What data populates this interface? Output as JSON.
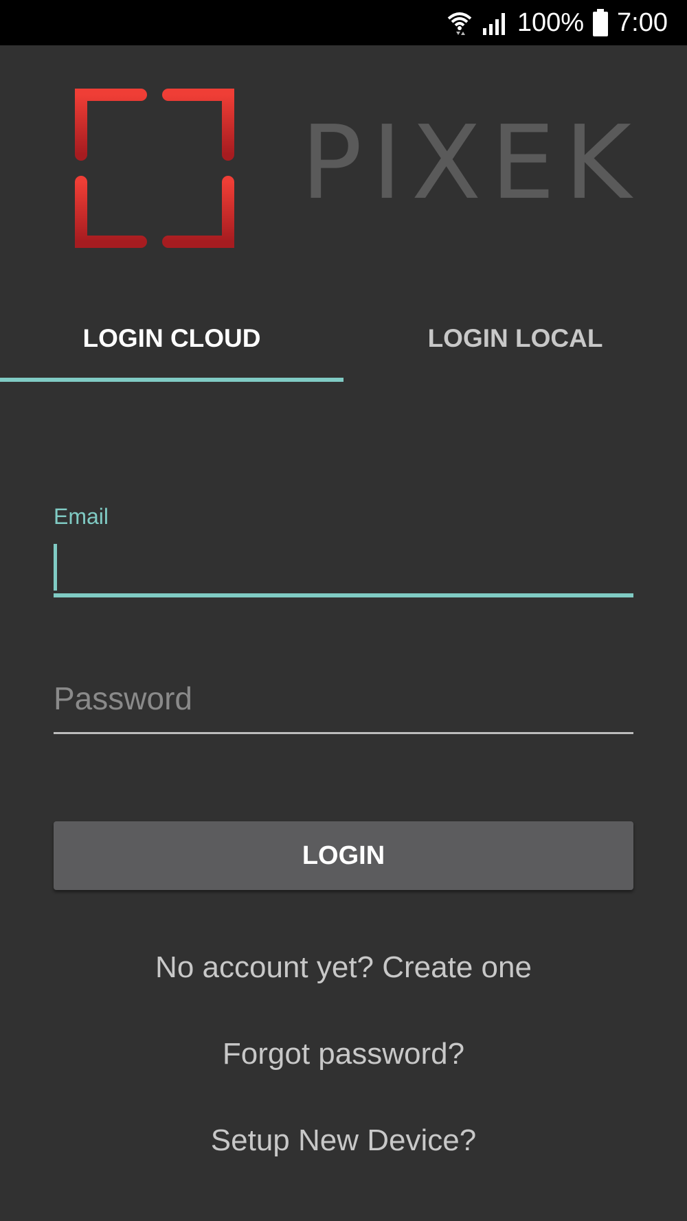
{
  "status_bar": {
    "battery_text": "100%",
    "time": "7:00",
    "icons": [
      "wifi-icon",
      "signal-icon",
      "battery-icon"
    ]
  },
  "brand": {
    "name": "PIXEK",
    "logo_color": "#e53935",
    "logo_icon": "frame-corners-logo"
  },
  "tabs": [
    {
      "label": "LOGIN CLOUD",
      "active": true
    },
    {
      "label": "LOGIN LOCAL",
      "active": false
    }
  ],
  "form": {
    "email_label": "Email",
    "email_value": "",
    "password_placeholder": "Password",
    "login_button": "LOGIN"
  },
  "links": {
    "create_account": "No account yet? Create one",
    "forgot_password": "Forgot password?",
    "setup_device": "Setup New Device?"
  },
  "colors": {
    "accent": "#80cbc4",
    "background": "#313131",
    "button": "#5c5c5e"
  }
}
